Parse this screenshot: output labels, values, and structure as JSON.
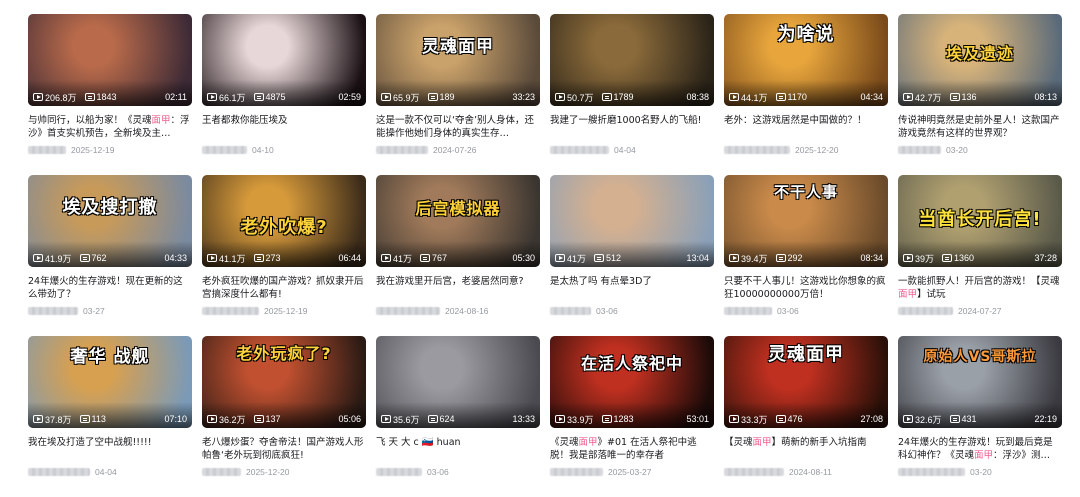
{
  "videos": [
    {
      "title": "与帅同行，以船为家！《灵魂面甲：浮沙》首支实机预告，全新埃及主…",
      "views": "206.8万",
      "danmaku": "1843",
      "duration": "02:11",
      "date": "2025-12-19",
      "caption": "",
      "accent": "#b86a4a",
      "bg2": "#3d2a36"
    },
    {
      "title": "王者都救你能压埃及",
      "views": "66.1万",
      "danmaku": "4875",
      "duration": "02:59",
      "date": "04-10",
      "caption": "",
      "accent": "#e8d7d8",
      "bg2": "#1a1014"
    },
    {
      "title": "这是一款不仅可以‘夺舍’别人身体，还能操作他她们身体的真实生存…",
      "views": "65.9万",
      "danmaku": "189",
      "duration": "33:23",
      "date": "2024-07-26",
      "caption": "灵魂面甲",
      "accent": "#c9a16a",
      "bg2": "#5a4a3a"
    },
    {
      "title": "我建了一艘折磨1000名野人的飞船!",
      "views": "50.7万",
      "danmaku": "1789",
      "duration": "08:38",
      "date": "04-04",
      "caption": "",
      "accent": "#8a6a3a",
      "bg2": "#2a2318"
    },
    {
      "title": "老外：这游戏居然是中国做的？！",
      "views": "44.1万",
      "danmaku": "1170",
      "duration": "04:34",
      "date": "2025-12-20",
      "caption": "为啥说",
      "accent": "#e7a53c",
      "bg2": "#7a4a1a"
    },
    {
      "title": "传说神明竟然是史前外星人！这款国产游戏竟然有这样的世界观？",
      "views": "42.7万",
      "danmaku": "136",
      "duration": "08:13",
      "date": "03-20",
      "caption": "埃及遗迹",
      "accent": "#d7b37a",
      "bg2": "#5a6a7a"
    },
    {
      "title": "24年爆火的生存游戏！现在更新的这么带劲了？",
      "views": "41.9万",
      "danmaku": "762",
      "duration": "04:33",
      "date": "03-27",
      "caption": "埃及搜打撤",
      "accent": "#c79a5a",
      "bg2": "#7a8aa0"
    },
    {
      "title": "老外疯狂吹爆的国产游戏？抓奴隶开后宫搞深度什么都有!",
      "views": "41.1万",
      "danmaku": "273",
      "duration": "06:44",
      "date": "2025-12-19",
      "caption": "老外吹爆?",
      "accent": "#d69a3a",
      "bg2": "#3a2a1a"
    },
    {
      "title": "我在游戏里开后宫，老婆居然同意?",
      "views": "41万",
      "danmaku": "767",
      "duration": "05:30",
      "date": "2024-08-16",
      "caption": "后宫模拟器",
      "accent": "#a07a5a",
      "bg2": "#3a3530"
    },
    {
      "title": "是太热了吗 有点晕3D了",
      "views": "41万",
      "danmaku": "512",
      "duration": "13:04",
      "date": "03-06",
      "caption": "",
      "accent": "#d4b090",
      "bg2": "#8aa0b8"
    },
    {
      "title": "只要不干人事儿！这游戏比你想象的疯狂10000000000万倍！",
      "views": "39.4万",
      "danmaku": "292",
      "duration": "08:34",
      "date": "03-06",
      "caption": "不干人事",
      "accent": "#c98a4a",
      "bg2": "#6a4a2a"
    },
    {
      "title": "一款能抓野人！开后宫的游戏！【灵魂面甲】试玩",
      "views": "39万",
      "danmaku": "1360",
      "duration": "37:28",
      "date": "2024-07-27",
      "caption": "当酋长开后宫!",
      "accent": "#b0a070",
      "bg2": "#5a5a4a"
    },
    {
      "title": "我在埃及打造了空中战舰!!!!!",
      "views": "37.8万",
      "danmaku": "113",
      "duration": "07:10",
      "date": "04-04",
      "caption": "奢华 战舰",
      "accent": "#d7a050",
      "bg2": "#7a9ab8"
    },
    {
      "title": "老八爆炒蛋？夺舍帝法！国产游戏人形帕鲁‘老外玩到彻底疯狂!",
      "views": "36.2万",
      "danmaku": "137",
      "duration": "05:06",
      "date": "2025-12-20",
      "caption": "老外玩疯了?",
      "accent": "#c05030",
      "bg2": "#2a1a14"
    },
    {
      "title": "飞 天 大 c 🇸🇮 huan",
      "views": "35.6万",
      "danmaku": "624",
      "duration": "13:33",
      "date": "03-06",
      "caption": "",
      "accent": "#9a9aa0",
      "bg2": "#4a4a50"
    },
    {
      "title": "《灵魂面甲》#01 在活人祭祀中逃脱！我是部落唯一的幸存者",
      "views": "33.9万",
      "danmaku": "1283",
      "duration": "53:01",
      "date": "2025-03-27",
      "caption": "在活人祭祀中",
      "accent": "#c03020",
      "bg2": "#1a0a08"
    },
    {
      "title": "【灵魂面甲】萌新的新手入坑指南",
      "views": "33.3万",
      "danmaku": "476",
      "duration": "27:08",
      "date": "2024-08-11",
      "caption": "灵魂面甲",
      "accent": "#c03020",
      "bg2": "#2a1008"
    },
    {
      "title": "24年爆火的生存游戏！玩到最后竟是科幻神作？《灵魂面甲：浮沙》测…",
      "views": "32.6万",
      "danmaku": "431",
      "duration": "22:19",
      "date": "03-20",
      "caption": "原始人VS哥斯拉",
      "accent": "#9aa0a8",
      "bg2": "#3a3a40"
    }
  ],
  "colors": {
    "highlight": "#f25d8e",
    "meta": "#9499a0",
    "title": "#18191c"
  },
  "icons": {
    "views": "play-icon",
    "danmaku": "danmaku-icon"
  }
}
